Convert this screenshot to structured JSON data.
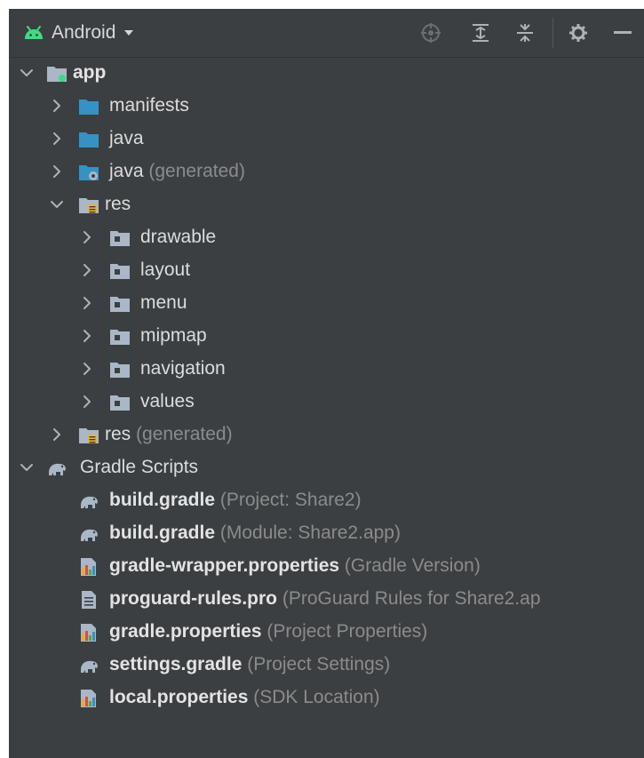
{
  "toolbar": {
    "view_label": "Android",
    "icons": [
      "android-icon",
      "dropdown-caret-icon",
      "locate-icon",
      "expand-all-icon",
      "collapse-all-icon",
      "gear-icon",
      "minimize-icon"
    ]
  },
  "tree": {
    "app": "app",
    "manifests": "manifests",
    "java": "java",
    "java_generated": "java",
    "java_generated_hint": "(generated)",
    "res": "res",
    "res_children": [
      "drawable",
      "layout",
      "menu",
      "mipmap",
      "navigation",
      "values"
    ],
    "res_generated": "res",
    "res_generated_hint": "(generated)",
    "gradle_scripts": "Gradle Scripts",
    "gradle_files": [
      {
        "name": "build.gradle",
        "hint": "(Project: Share2)",
        "icon": "gradle-elephant-icon"
      },
      {
        "name": "build.gradle",
        "hint": "(Module: Share2.app)",
        "icon": "gradle-elephant-icon"
      },
      {
        "name": "gradle-wrapper.properties",
        "hint": "(Gradle Version)",
        "icon": "properties-file-icon"
      },
      {
        "name": "proguard-rules.pro",
        "hint": "(ProGuard Rules for Share2.ap",
        "icon": "text-file-icon"
      },
      {
        "name": "gradle.properties",
        "hint": "(Project Properties)",
        "icon": "properties-file-icon"
      },
      {
        "name": "settings.gradle",
        "hint": "(Project Settings)",
        "icon": "gradle-elephant-icon"
      },
      {
        "name": "local.properties",
        "hint": "(SDK Location)",
        "icon": "properties-file-icon"
      }
    ]
  },
  "colors": {
    "panel_bg": "#3c3f41",
    "text": "#dcdcdc",
    "hint": "#8b8b8b",
    "folder_blue": "#3592c4",
    "folder_gray": "#a9b7c6",
    "android_green": "#3ddc84"
  }
}
